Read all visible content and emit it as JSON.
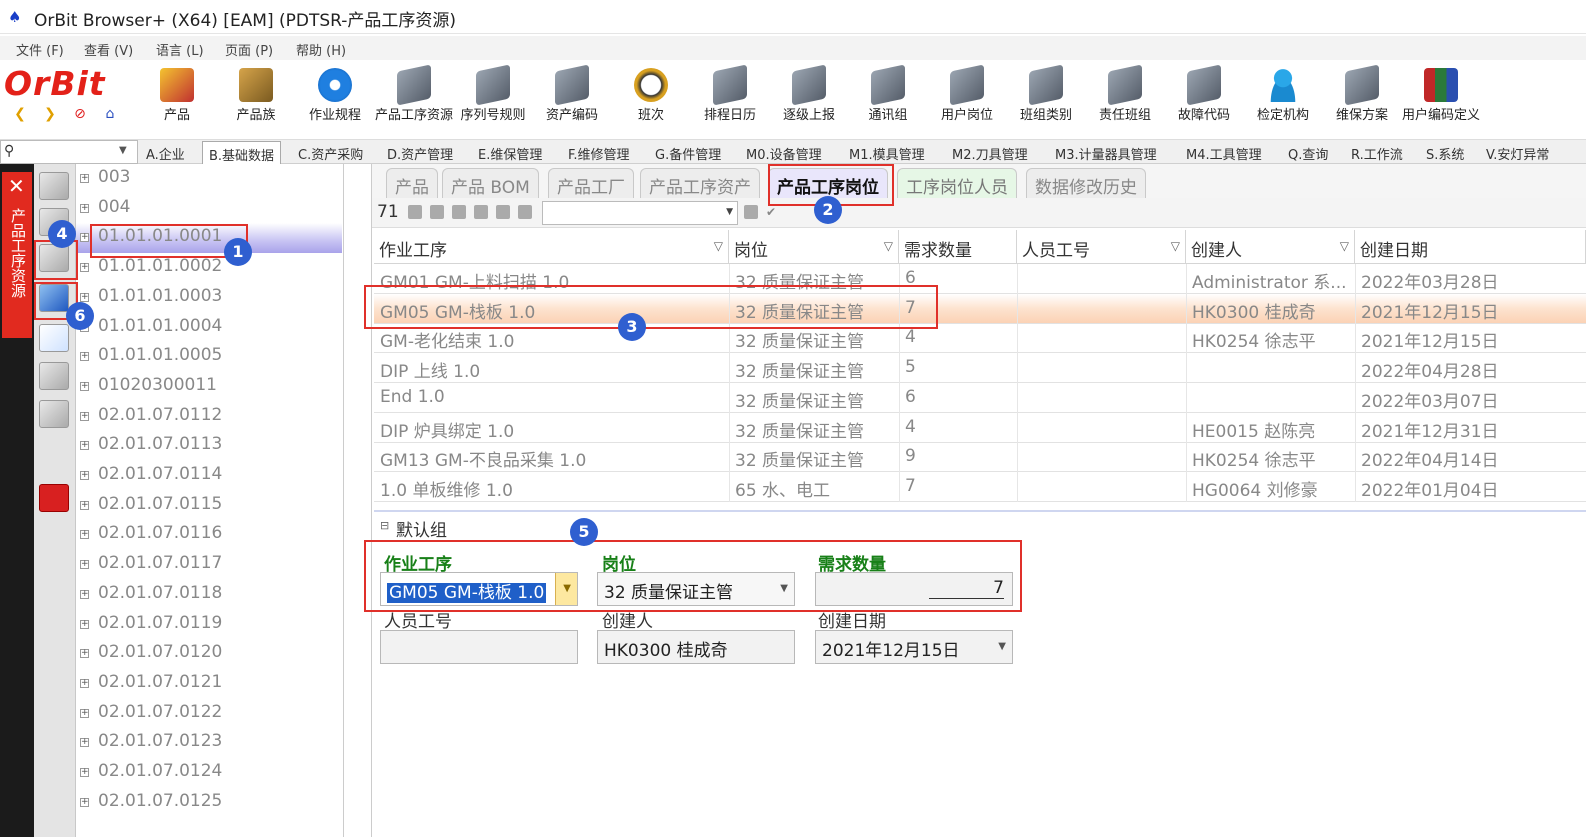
{
  "window": {
    "title": "OrBit Browser+ (X64) [EAM] (PDTSR-产品工序资源)"
  },
  "menu": [
    "文件 (F)",
    "查看 (V)",
    "语言 (L)",
    "页面 (P)",
    "帮助 (H)"
  ],
  "logo": "OrBit",
  "toolbar": [
    "产品",
    "产品族",
    "作业规程",
    "产品工序资源",
    "序列号规则",
    "资产编码",
    "班次",
    "排程日历",
    "逐级上报",
    "通讯组",
    "用户岗位",
    "班组类别",
    "责任班组",
    "故障代码",
    "检定机构",
    "维保方案",
    "用户编码定义"
  ],
  "modules": [
    "A.企业",
    "B.基础数据",
    "C.资产采购",
    "D.资产管理",
    "E.维保管理",
    "F.维修管理",
    "G.备件管理",
    "M0.设备管理",
    "M1.模具管理",
    "M2.刀具管理",
    "M3.计量器具管理",
    "M4.工具管理",
    "Q.查询",
    "R.工作流",
    "S.系统",
    "V.安灯异常"
  ],
  "active_module": "B.基础数据",
  "side_panel_title": "产品工序资源",
  "tree": [
    "003",
    "004",
    "01.01.01.0001",
    "01.01.01.0002",
    "01.01.01.0003",
    "01.01.01.0004",
    "01.01.01.0005",
    "01020300011",
    "02.01.07.0112",
    "02.01.07.0113",
    "02.01.07.0114",
    "02.01.07.0115",
    "02.01.07.0116",
    "02.01.07.0117",
    "02.01.07.0118",
    "02.01.07.0119",
    "02.01.07.0120",
    "02.01.07.0121",
    "02.01.07.0122",
    "02.01.07.0123",
    "02.01.07.0124",
    "02.01.07.0125"
  ],
  "selected_tree_index": 2,
  "tabs": [
    "产品",
    "产品 BOM",
    "产品工厂",
    "产品工序资产",
    "产品工序岗位",
    "工序岗位人员",
    "数据修改历史"
  ],
  "active_tab_index": 4,
  "grid": {
    "record_count": "71",
    "columns": [
      "作业工序",
      "岗位",
      "需求数量",
      "人员工号",
      "创建人",
      "创建日期"
    ],
    "rows": [
      [
        "GM01 GM-上料扫描 1.0",
        "32 质量保证主管",
        "6",
        "",
        "Administrator 系...",
        "2022年03月28日"
      ],
      [
        "GM05 GM-栈板 1.0",
        "32 质量保证主管",
        "7",
        "",
        "HK0300 桂成奇",
        "2021年12月15日"
      ],
      [
        "GM-老化结束 1.0",
        "32 质量保证主管",
        "4",
        "",
        "HK0254 徐志平",
        "2021年12月15日"
      ],
      [
        "DIP 上线 1.0",
        "32 质量保证主管",
        "5",
        "",
        "",
        "2022年04月28日"
      ],
      [
        "End 1.0",
        "32 质量保证主管",
        "6",
        "",
        "",
        "2022年03月07日"
      ],
      [
        "DIP 炉具绑定 1.0",
        "32 质量保证主管",
        "4",
        "",
        "HE0015 赵陈亮",
        "2021年12月31日"
      ],
      [
        "GM13 GM-不良品采集 1.0",
        "32 质量保证主管",
        "9",
        "",
        "HK0254 徐志平",
        "2022年04月14日"
      ],
      [
        "1.0 单板维修 1.0",
        "65 水、电工",
        "7",
        "",
        "HG0064 刘修豪",
        "2022年01月04日"
      ]
    ],
    "highlighted_row": 1
  },
  "form": {
    "group_title": "默认组",
    "labels": {
      "operation": "作业工序",
      "post": "岗位",
      "qty": "需求数量",
      "employee": "人员工号",
      "creator": "创建人",
      "created": "创建日期"
    },
    "values": {
      "operation": "GM05 GM-栈板 1.0",
      "post": "32 质量保证主管",
      "qty": "7",
      "employee": "",
      "creator": "HK0300 桂成奇",
      "created": "2021年12月15日"
    }
  },
  "badges": [
    "1",
    "2",
    "3",
    "4",
    "5",
    "6"
  ],
  "colors": {
    "accent_red": "#e0302a",
    "badge_blue": "#2f5fd0",
    "label_green": "#188018"
  }
}
